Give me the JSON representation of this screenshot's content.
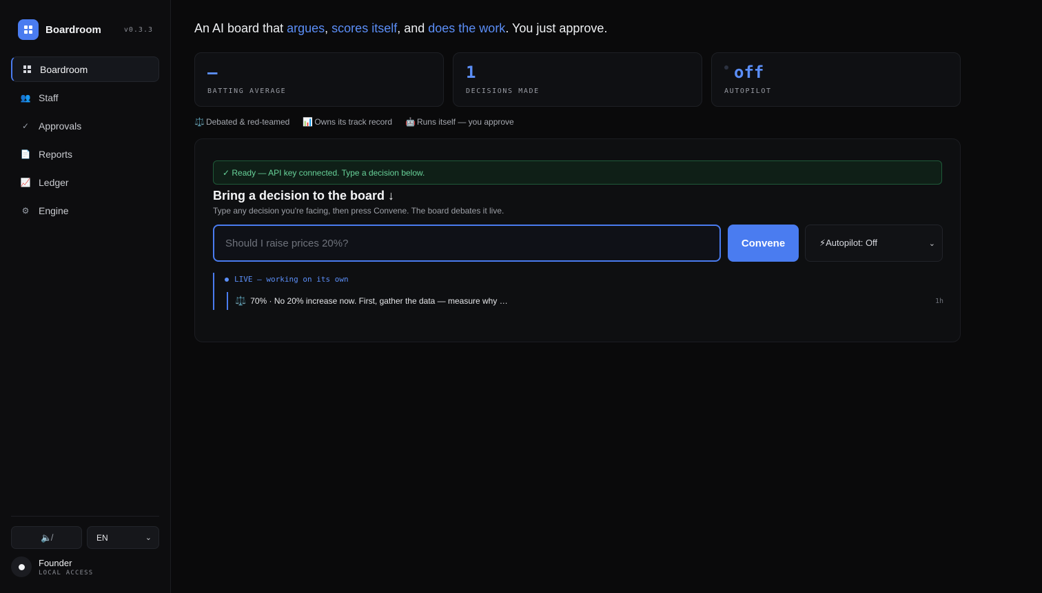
{
  "brand": {
    "name": "Boardroom",
    "version": "v0.3.3"
  },
  "nav": [
    {
      "label": "Boardroom",
      "icon": "grid-icon",
      "active": true
    },
    {
      "label": "Staff",
      "icon": "people-icon"
    },
    {
      "label": "Approvals",
      "icon": "check-icon"
    },
    {
      "label": "Reports",
      "icon": "document-icon"
    },
    {
      "label": "Ledger",
      "icon": "chart-icon"
    },
    {
      "label": "Engine",
      "icon": "gear-icon"
    }
  ],
  "footer": {
    "sound_icon": "speaker-muted-icon",
    "language": "EN",
    "user_name": "Founder",
    "user_role": "LOCAL ACCESS"
  },
  "headline": {
    "p1": "An AI board that ",
    "h1": "argues",
    "p2": ", ",
    "h2": "scores itself",
    "p3": ", and ",
    "h3": "does the work",
    "p4": ". You just approve."
  },
  "stats": [
    {
      "value": "–",
      "label": "BATTING AVERAGE"
    },
    {
      "value": "1",
      "label": "DECISIONS MADE"
    },
    {
      "value": "off",
      "label": "AUTOPILOT"
    }
  ],
  "features": [
    {
      "icon": "scales-icon",
      "label": "Debated & red-teamed"
    },
    {
      "icon": "bar-chart-icon",
      "label": "Owns its track record"
    },
    {
      "icon": "robot-icon",
      "label": "Runs itself — you approve"
    }
  ],
  "panel": {
    "ready": "✓ Ready — API key connected. Type a decision below.",
    "title": "Bring a decision to the board ↓",
    "subtitle": "Type any decision you're facing, then press Convene. The board debates it live.",
    "input_placeholder": "Should I raise prices 20%?",
    "input_value": "",
    "convene_label": "Convene",
    "autopilot_label": "⚡Autopilot: Off"
  },
  "live": {
    "header": "LIVE — working on its own",
    "items": [
      {
        "text": "70% · No 20% increase now. First, gather the data — measure why …",
        "time": "1h"
      }
    ]
  },
  "colors": {
    "accent": "#4a7cf0",
    "success": "#68d39a",
    "background": "#0a0a0b"
  }
}
